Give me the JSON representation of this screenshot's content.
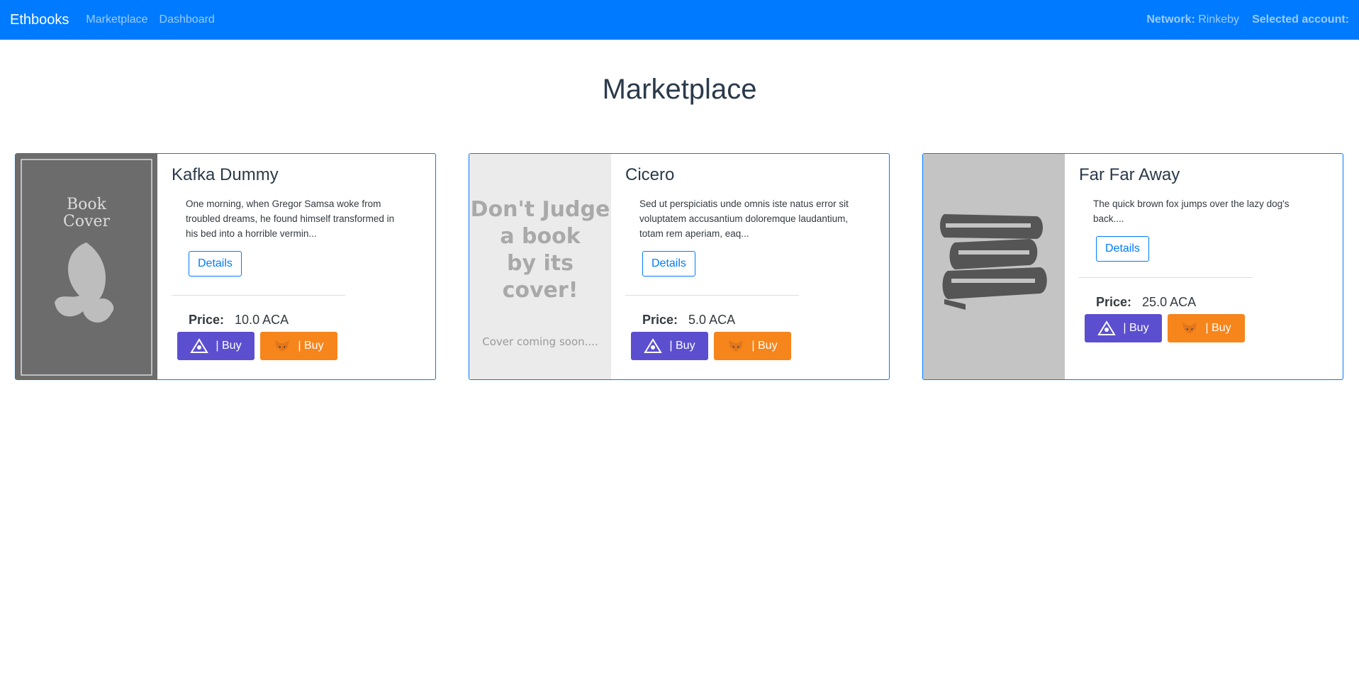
{
  "navbar": {
    "brand": "Ethbooks",
    "links": [
      "Marketplace",
      "Dashboard"
    ],
    "network_label": "Network:",
    "network_value": "Rinkeby",
    "account_label": "Selected account:"
  },
  "page": {
    "title": "Marketplace"
  },
  "cards": [
    {
      "title": "Kafka Dummy",
      "description": "One morning, when Gregor Samsa woke from troubled dreams, he found himself transformed in his bed into a horrible vermin...",
      "details_label": "Details",
      "price_label": "Price:",
      "price": "10.0 ACA",
      "cover_text": [
        "Book",
        "Cover"
      ],
      "buy_label": "| Buy",
      "buy2_label": "| Buy"
    },
    {
      "title": "Cicero",
      "description": "Sed ut perspiciatis unde omnis iste natus error sit voluptatem accusantium doloremque laudantium, totam rem aperiam, eaq...",
      "details_label": "Details",
      "price_label": "Price:",
      "price": "5.0 ACA",
      "cover_text": [
        "Don't Judge",
        "a book",
        "by its",
        "cover!"
      ],
      "cover_subtext": "Cover coming soon....",
      "buy_label": "| Buy",
      "buy2_label": "| Buy"
    },
    {
      "title": "Far Far Away",
      "description": "The quick brown fox jumps over the lazy dog's back....",
      "details_label": "Details",
      "price_label": "Price:",
      "price": "25.0 ACA",
      "buy_label": "| Buy",
      "buy2_label": "| Buy"
    }
  ],
  "colors": {
    "navbar": "#007bff",
    "purple_button": "#5b4fcf",
    "orange_button": "#f6851b"
  },
  "icons": {
    "purple_button_icon": "aca-token-icon",
    "orange_button_icon": "metamask-fox-icon"
  }
}
